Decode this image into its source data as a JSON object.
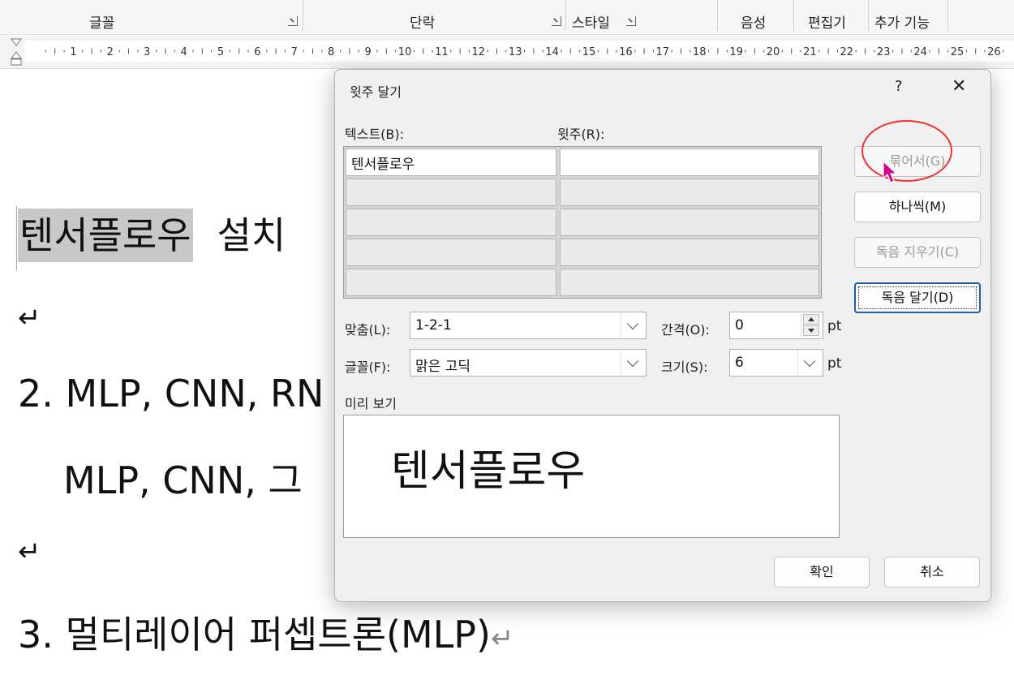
{
  "ribbon": {
    "groups": [
      "글꼴",
      "단락",
      "스타일",
      "음성",
      "편집기",
      "추가 기능"
    ]
  },
  "ruler": {
    "numbers": [
      "1",
      "2",
      "3",
      "4",
      "5",
      "6",
      "7",
      "8",
      "9",
      "10",
      "11",
      "12",
      "13",
      "14",
      "15",
      "16",
      "17",
      "18",
      "19",
      "20",
      "21",
      "22",
      "23",
      "24",
      "25",
      "26"
    ]
  },
  "document": {
    "line1_highlight": "텐서플로우",
    "line1_rest": "설치",
    "return_mark": "↵",
    "line2": "2. MLP, CNN, RN",
    "line3": "MLP, CNN, 그",
    "line4": "3. 멀티레이어 퍼셉트론(MLP)"
  },
  "dialog": {
    "title": "윗주 달기",
    "help": "?",
    "close": "✕",
    "text_label": "텍스트(B):",
    "ruby_label": "윗주(R):",
    "rows": [
      {
        "text": "텐서플로우",
        "ruby": ""
      },
      {
        "text": "",
        "ruby": ""
      },
      {
        "text": "",
        "ruby": ""
      },
      {
        "text": "",
        "ruby": ""
      },
      {
        "text": "",
        "ruby": ""
      }
    ],
    "align_label": "맞춤(L):",
    "align_value": "1-2-1",
    "offset_label": "간격(O):",
    "offset_value": "0",
    "font_label": "글꼴(F):",
    "font_value": "맑은 고딕",
    "size_label": "크기(S):",
    "size_value": "6",
    "unit": "pt",
    "preview_label": "미리 보기",
    "preview_text": "텐서플로우",
    "buttons": {
      "group": "묶어서(G)",
      "mono": "하나씩(M)",
      "clear": "독음 지우기(C)",
      "apply": "독음 달기(D)",
      "ok": "확인",
      "cancel": "취소"
    }
  },
  "colors": {
    "annotation_circle": "#ee3333",
    "cursor": "#d4008a",
    "default_button_border": "#1f5fa8"
  }
}
